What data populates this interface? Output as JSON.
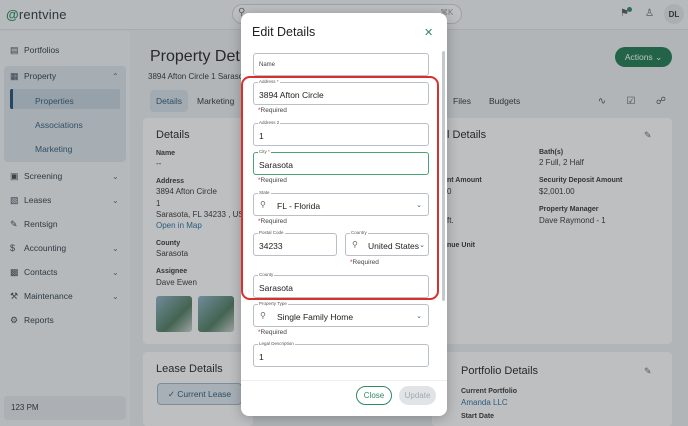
{
  "app": {
    "logo_prefix": "@",
    "logo_text": "rentvine",
    "search_placeholder": "Search",
    "search_shortcut": "⌘K",
    "user_initials": "DL"
  },
  "sidebar": {
    "items": [
      {
        "label": "Portfolios",
        "icon": "folder-icon"
      },
      {
        "label": "Property",
        "icon": "building-icon"
      },
      {
        "label": "Screening",
        "icon": "screening-icon"
      },
      {
        "label": "Leases",
        "icon": "document-icon"
      },
      {
        "label": "Rentsign",
        "icon": "pen-icon"
      },
      {
        "label": "Accounting",
        "icon": "dollar-icon"
      },
      {
        "label": "Contacts",
        "icon": "contacts-icon"
      },
      {
        "label": "Maintenance",
        "icon": "wrench-icon"
      },
      {
        "label": "Reports",
        "icon": "gear-icon"
      }
    ],
    "property_sub": [
      "Properties",
      "Associations",
      "Marketing"
    ],
    "time": "123 PM"
  },
  "page": {
    "title": "Property Det",
    "subtitle": "3894 Afton Circle 1 Sarasota",
    "actions_label": "Actions",
    "tabs": [
      "Details",
      "Marketing",
      "Files",
      "Budgets"
    ],
    "details": {
      "heading": "Details",
      "name_label": "Name",
      "name_value": "--",
      "address_label": "Address",
      "address_lines": [
        "3894 Afton Circle",
        "1",
        "Sarasota, FL 34233 , US"
      ],
      "map_link": "Open in Map",
      "county_label": "County",
      "county_value": "Sarasota",
      "assignee_label": "Assignee",
      "assignee_value": "Dave Ewen"
    },
    "right_details": {
      "heading": "l Details",
      "baths_label": "Bath(s)",
      "baths_value": "2 Full, 2 Half",
      "rent_label": "nt Amount",
      "rent_value": "0",
      "deposit_label": "Security Deposit Amount",
      "deposit_value": "$2,001.00",
      "sqft_value": "ft.",
      "manager_label": "Property Manager",
      "manager_value": "Dave Raymond - 1",
      "revenue_label": "nue Unit"
    },
    "lease": {
      "heading": "Lease Details",
      "current_label": "Current Lease"
    },
    "portfolio": {
      "heading": "Portfolio Details",
      "current_label": "Current Portfolio",
      "current_value": "Amanda LLC",
      "start_label": "Start Date"
    }
  },
  "modal": {
    "title": "Edit Details",
    "fields": {
      "name": {
        "placeholder": "Name"
      },
      "address": {
        "label": "Address",
        "value": "3894 Afton Circle",
        "required": "Required"
      },
      "address2": {
        "label": "Address 2",
        "value": "1"
      },
      "city": {
        "label": "City",
        "value": "Sarasota",
        "required": "Required"
      },
      "state": {
        "label": "State",
        "value": "FL - Florida",
        "required": "Required"
      },
      "postal": {
        "label": "Postal Code",
        "value": "34233"
      },
      "country": {
        "label": "Country",
        "value": "United States",
        "required": "Required"
      },
      "county": {
        "label": "County",
        "value": "Sarasota"
      },
      "property_type": {
        "label": "Property Type",
        "value": "Single Family Home",
        "required": "Required"
      },
      "legal": {
        "label": "Legal Description",
        "value": "1"
      }
    },
    "close_label": "Close",
    "update_label": "Update"
  },
  "colors": {
    "brand_green": "#1d7a4f",
    "highlight_red": "#d9302c",
    "nav_blue": "#1e4f76"
  }
}
